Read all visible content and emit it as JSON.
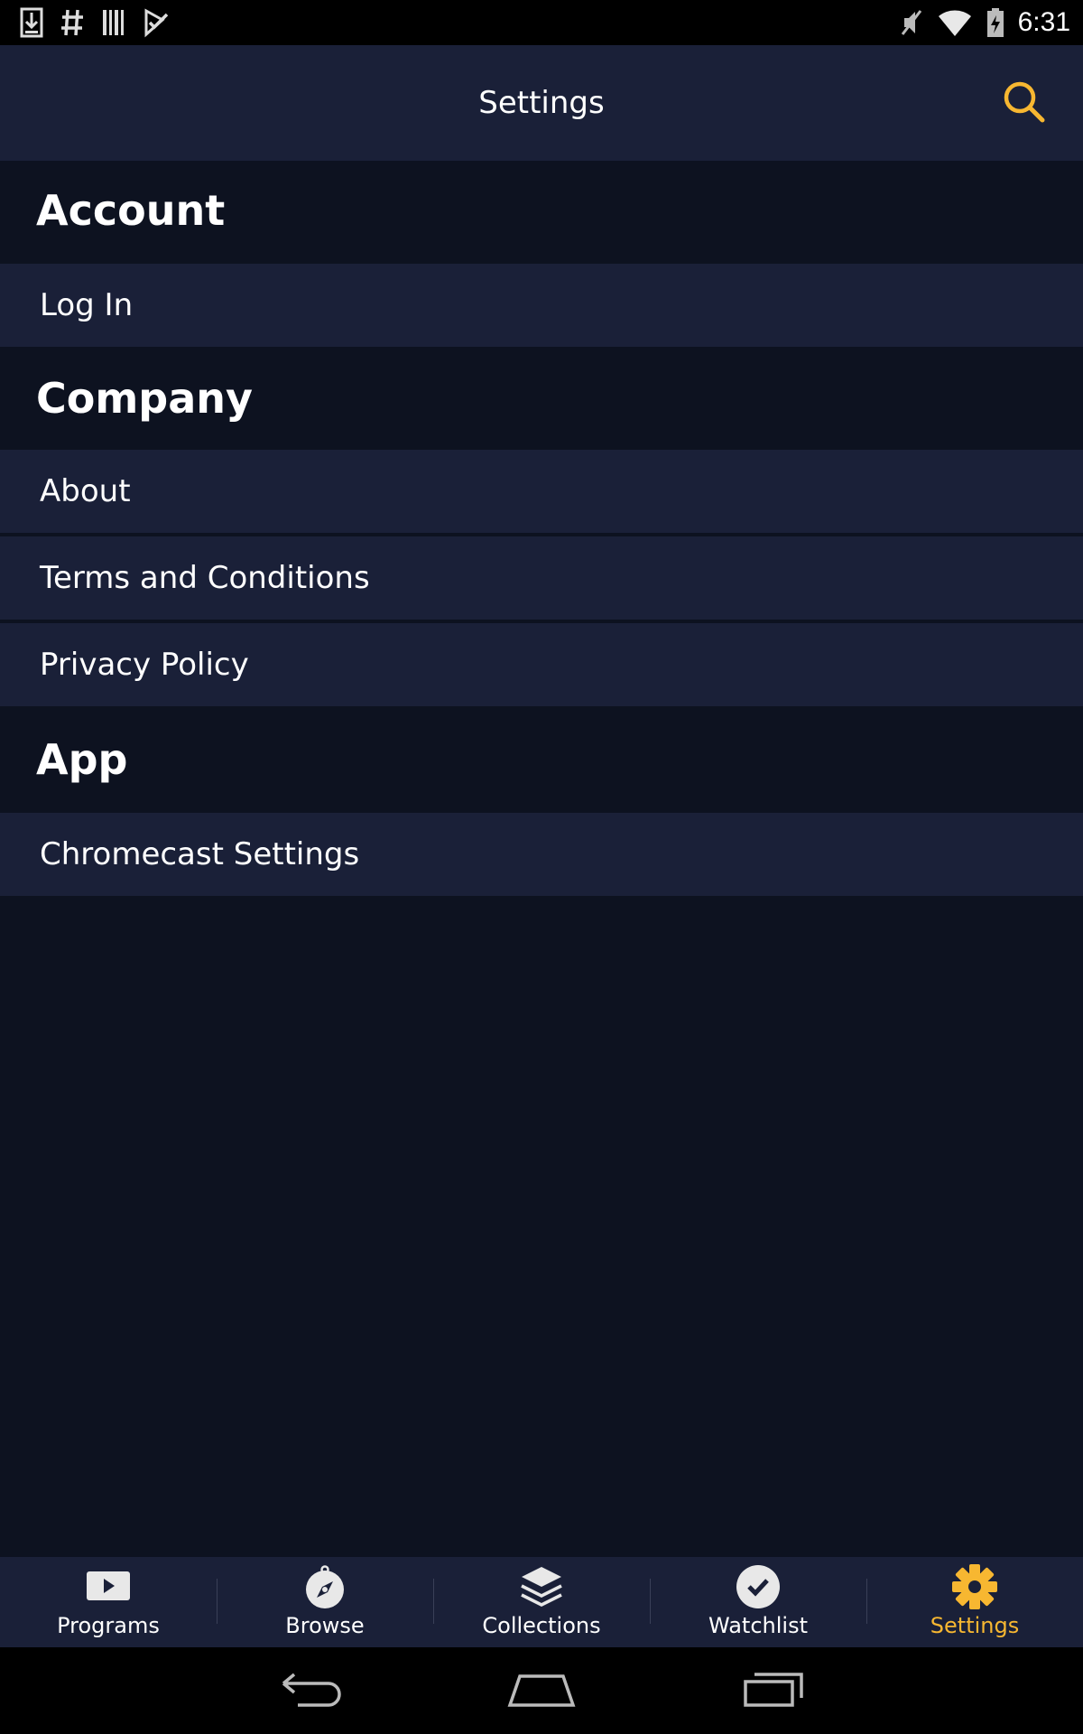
{
  "status_bar": {
    "time": "6:31",
    "left_icons": [
      "download-icon",
      "hash-icon",
      "barcode-icon",
      "task-icon"
    ],
    "right_icons": [
      "mute-icon",
      "wifi-icon",
      "battery-icon"
    ]
  },
  "app_bar": {
    "title": "Settings",
    "search_icon": "search-icon"
  },
  "sections": [
    {
      "header": "Account",
      "items": [
        "Log In"
      ]
    },
    {
      "header": "Company",
      "items": [
        "About",
        "Terms and Conditions",
        "Privacy Policy"
      ]
    },
    {
      "header": "App",
      "items": [
        "Chromecast Settings"
      ]
    }
  ],
  "bottom_nav": {
    "items": [
      {
        "label": "Programs",
        "icon": "play-icon"
      },
      {
        "label": "Browse",
        "icon": "compass-icon"
      },
      {
        "label": "Collections",
        "icon": "layers-icon"
      },
      {
        "label": "Watchlist",
        "icon": "check-circle-icon"
      },
      {
        "label": "Settings",
        "icon": "gear-icon"
      }
    ],
    "active_index": 4
  },
  "system_nav": {
    "buttons": [
      "back-icon",
      "home-icon",
      "recents-icon"
    ]
  },
  "colors": {
    "accent": "#f7b731",
    "background": "#0d1220",
    "surface": "#1a2038",
    "status_bar": "#000000"
  }
}
